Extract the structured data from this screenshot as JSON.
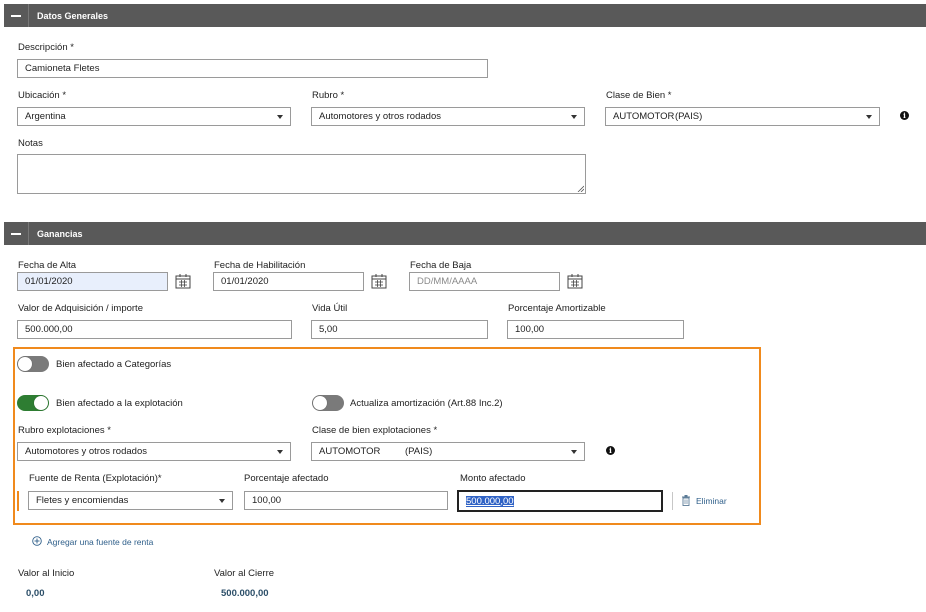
{
  "sections": {
    "general": "Datos Generales",
    "ganancias": "Ganancias"
  },
  "general": {
    "descripcion": {
      "label": "Descripción *",
      "value": "Camioneta Fletes"
    },
    "ubicacion": {
      "label": "Ubicación *",
      "value": "Argentina"
    },
    "rubro": {
      "label": "Rubro *",
      "value": "Automotores y otros rodados"
    },
    "clase_bien": {
      "label": "Clase de Bien *",
      "code": "AUTOMOTOR",
      "origin": "(PAIS)"
    },
    "notas": {
      "label": "Notas",
      "value": ""
    }
  },
  "ganancias": {
    "fecha_alta": {
      "label": "Fecha de Alta",
      "value": "01/01/2020"
    },
    "fecha_habilitacion": {
      "label": "Fecha de Habilitación",
      "value": "01/01/2020"
    },
    "fecha_baja": {
      "label": "Fecha de Baja",
      "placeholder": "DD/MM/AAAA"
    },
    "valor_adquisicion": {
      "label": "Valor de Adquisición / importe",
      "value": "500.000,00"
    },
    "vida_util": {
      "label": "Vida Útil",
      "value": "5,00"
    },
    "porcentaje_amortizable": {
      "label": "Porcentaje Amortizable",
      "value": "100,00"
    },
    "toggle_categorias": {
      "label": "Bien afectado a Categorías",
      "on": false
    },
    "toggle_explotacion": {
      "label": "Bien afectado a la explotación",
      "on": true
    },
    "toggle_amortizacion": {
      "label": "Actualiza amortización (Art.88 Inc.2)",
      "on": false
    },
    "rubro_explotaciones": {
      "label": "Rubro explotaciones *",
      "value": "Automotores y otros rodados"
    },
    "clase_explotaciones": {
      "label": "Clase de bien explotaciones *",
      "code": "AUTOMOTOR",
      "origin": "(PAIS)"
    },
    "fuente_renta": {
      "label": "Fuente de Renta (Explotación)*",
      "value": "Fletes y encomiendas"
    },
    "porcentaje_afectado": {
      "label": "Porcentaje afectado",
      "value": "100,00"
    },
    "monto_afectado": {
      "label": "Monto afectado",
      "value": "500.000,00"
    },
    "eliminar": "Eliminar",
    "agregar": "Agregar una fuente de renta",
    "valor_inicio": {
      "label": "Valor al Inicio",
      "value": "0,00"
    },
    "valor_cierre": {
      "label": "Valor al Cierre",
      "value": "500.000,00"
    }
  },
  "icons": {
    "collapse": "minus-icon",
    "calendar": "calendar-icon",
    "info": "info-icon",
    "trash": "trash-icon",
    "add": "plus-circle-icon",
    "dropdown": "chevron-down-icon"
  },
  "colors": {
    "section_bar": "#595959",
    "highlight_box": "#f08a1d",
    "toggle_on": "#2e7d32",
    "toggle_off": "#7a7a7a",
    "date_highlight": "#e8effc",
    "link": "#2f5f8a"
  }
}
